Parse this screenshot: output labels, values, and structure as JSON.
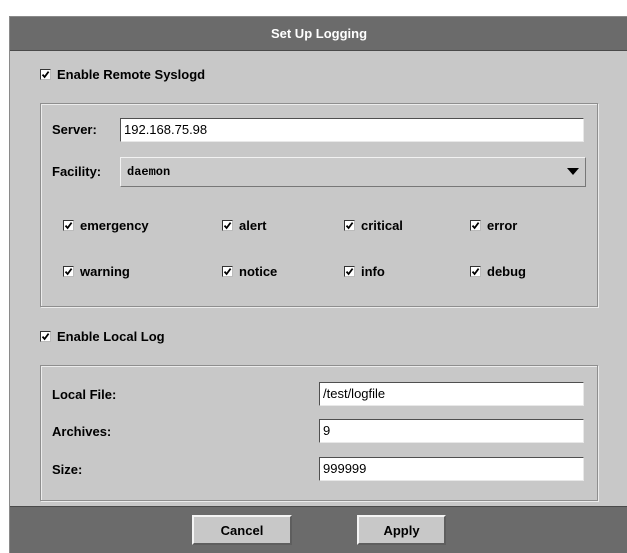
{
  "dialog": {
    "title": "Set Up Logging"
  },
  "remote": {
    "enable_label": "Enable Remote Syslogd",
    "enable_checked": true,
    "server_label": "Server:",
    "server_value": "192.168.75.98",
    "facility_label": "Facility:",
    "facility_value": "daemon",
    "levels": [
      {
        "label": "emergency",
        "checked": true
      },
      {
        "label": "alert",
        "checked": true
      },
      {
        "label": "critical",
        "checked": true
      },
      {
        "label": "error",
        "checked": true
      },
      {
        "label": "warning",
        "checked": true
      },
      {
        "label": "notice",
        "checked": true
      },
      {
        "label": "info",
        "checked": true
      },
      {
        "label": "debug",
        "checked": true
      }
    ]
  },
  "local": {
    "enable_label": "Enable Local Log",
    "enable_checked": true,
    "file_label": "Local File:",
    "file_value": "/test/logfile",
    "archives_label": "Archives:",
    "archives_value": "9",
    "size_label": "Size:",
    "size_value": "999999"
  },
  "footer": {
    "cancel_label": "Cancel",
    "apply_label": "Apply"
  },
  "icons": {
    "checkbox_mark": "checkmark-icon",
    "dropdown_arrow": "triangle-down-icon"
  }
}
